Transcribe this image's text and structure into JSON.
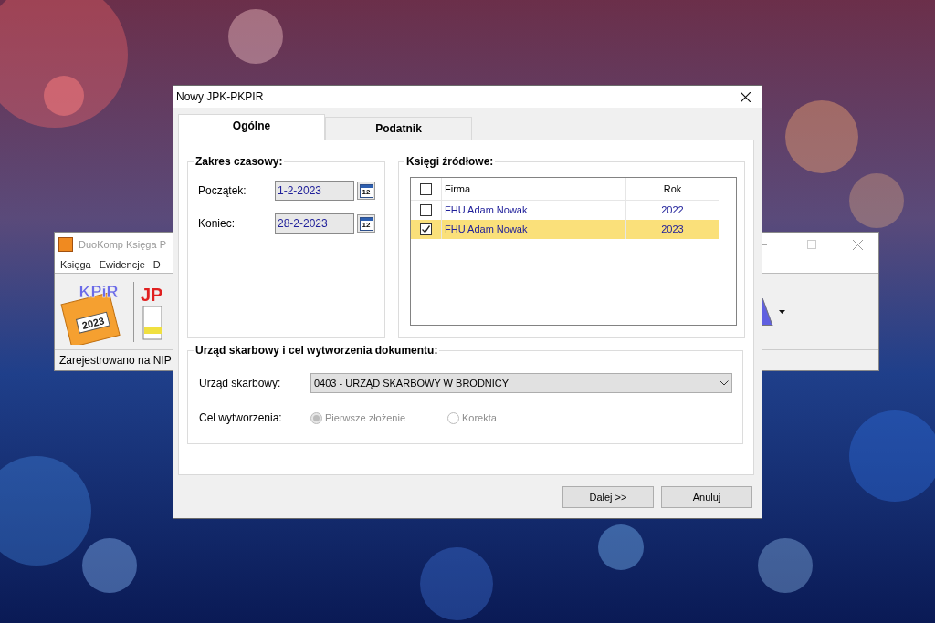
{
  "main_window": {
    "title": "DuoKomp Księga P",
    "menu": [
      "Księga",
      "Ewidencje",
      "D"
    ],
    "toolbar_logo": "KPiR",
    "toolbar_year": "2023",
    "toolbar_jpk": "JP",
    "status": "Zarejestrowano na NIP"
  },
  "dialog": {
    "title": "Nowy JPK-PKPIR",
    "tabs": [
      {
        "label": "Ogólne",
        "selected": true
      },
      {
        "label": "Podatnik",
        "selected": false
      }
    ],
    "period": {
      "title": "Zakres czasowy:",
      "fields": [
        {
          "label": "Początek:",
          "value": "1-2-2023",
          "calendar": "12"
        },
        {
          "label": "Koniec:",
          "value": "28-2-2023",
          "calendar": "12"
        }
      ]
    },
    "sources": {
      "title": "Księgi źródłowe:",
      "header_checked": false,
      "columns": [
        "Firma",
        "Rok"
      ],
      "rows": [
        {
          "firm": "FHU Adam Nowak",
          "year": "2022",
          "checked": false,
          "selected": false
        },
        {
          "firm": "FHU Adam Nowak",
          "year": "2023",
          "checked": true,
          "selected": true
        }
      ]
    },
    "office": {
      "title": "Urząd skarbowy i cel wytworzenia dokumentu:",
      "office_label": "Urząd skarbowy:",
      "office_value": "0403 - URZĄD SKARBOWY W BRODNICY",
      "purpose_label": "Cel wytworzenia:",
      "purposes": [
        {
          "label": "Pierwsze złożenie",
          "selected": true,
          "disabled": true
        },
        {
          "label": "Korekta",
          "selected": false,
          "disabled": true
        }
      ]
    },
    "buttons": [
      "Dalej >>",
      "Anuluj"
    ]
  }
}
